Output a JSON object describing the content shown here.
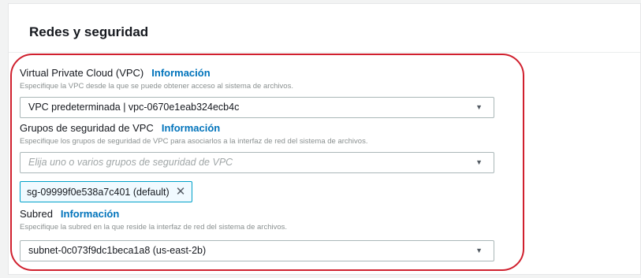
{
  "section": {
    "title": "Redes y seguridad"
  },
  "vpc": {
    "label": "Virtual Private Cloud (VPC)",
    "info": "Información",
    "description": "Especifique la VPC desde la que se puede obtener acceso al sistema de archivos.",
    "value": "VPC predeterminada | vpc-0670e1eab324ecb4c"
  },
  "security_groups": {
    "label": "Grupos de seguridad de VPC",
    "info": "Información",
    "description": "Especifique los grupos de seguridad de VPC para asociarlos a la interfaz de red del sistema de archivos.",
    "placeholder": "Elija uno o varios grupos de seguridad de VPC",
    "selected_token": "sg-09999f0e538a7c401 (default)",
    "remove_icon": "close-icon"
  },
  "subnet": {
    "label": "Subred",
    "info": "Información",
    "description": "Especifique la subred en la que reside la interfaz de red del sistema de archivos.",
    "value": "subnet-0c073f9dc1beca1a8 (us-east-2b)"
  },
  "colors": {
    "link": "#0073bb",
    "highlight": "#d0202e",
    "token_border": "#00a1c9"
  }
}
